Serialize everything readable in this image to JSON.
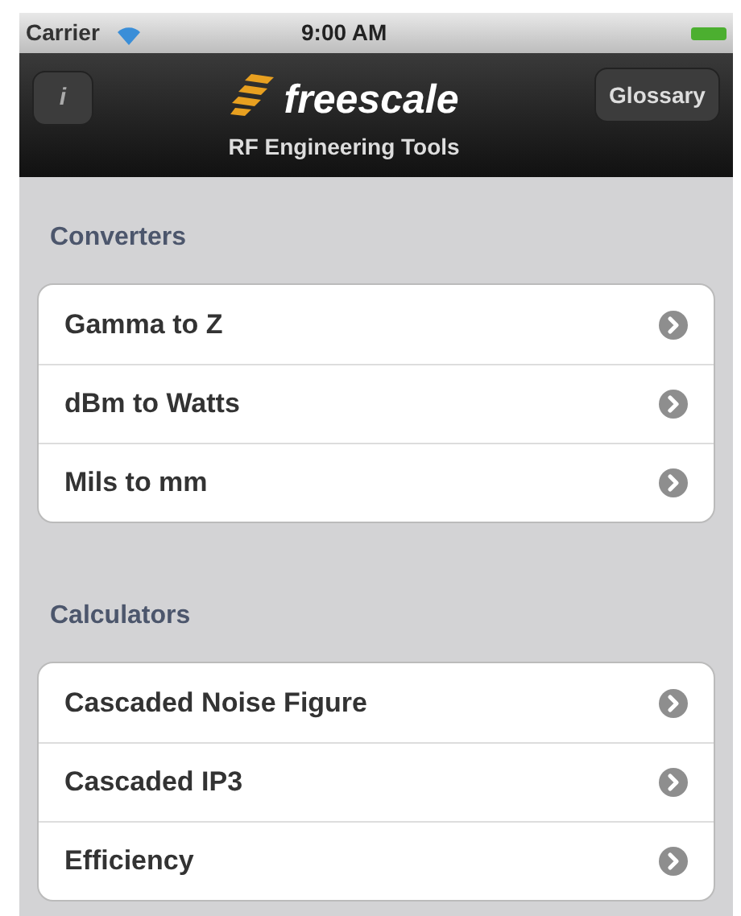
{
  "status_bar": {
    "carrier": "Carrier",
    "time": "9:00 AM"
  },
  "nav_bar": {
    "info_button": "i",
    "logo_text": "freescale",
    "subtitle": "RF Engineering Tools",
    "right_button": "Glossary"
  },
  "sections": [
    {
      "title": "Converters",
      "items": [
        "Gamma to Z",
        "dBm to Watts",
        "Mils to mm"
      ]
    },
    {
      "title": "Calculators",
      "items": [
        "Cascaded Noise Figure",
        "Cascaded IP3",
        "Efficiency"
      ]
    }
  ]
}
